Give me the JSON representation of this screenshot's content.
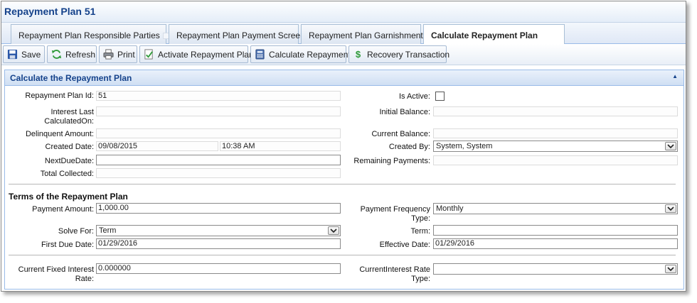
{
  "window": {
    "title": "Repayment Plan 51"
  },
  "tabs": [
    {
      "label": "Repayment Plan Responsible Parties"
    },
    {
      "label": "Repayment Plan Payment Screen"
    },
    {
      "label": "Repayment Plan Garnishments"
    },
    {
      "label": "Calculate Repayment Plan"
    }
  ],
  "toolbar": {
    "save": "Save",
    "refresh": "Refresh",
    "print": "Print",
    "activate": "Activate Repayment Plan",
    "calculate": "Calculate Repayment",
    "recovery": "Recovery Transaction"
  },
  "panel": {
    "title": "Calculate the Repayment Plan"
  },
  "fields": {
    "plan_id_label": "Repayment Plan Id:",
    "plan_id": "51",
    "is_active_label": "Is Active:",
    "interest_last_label_1": "Interest Last",
    "interest_last_label_2": "CalculatedOn:",
    "interest_last": "",
    "initial_balance_label": "Initial Balance:",
    "initial_balance": "",
    "delinquent_label": "Delinquent Amount:",
    "delinquent": "",
    "current_balance_label": "Current Balance:",
    "current_balance": "",
    "created_date_label": "Created Date:",
    "created_date": "09/08/2015",
    "created_time": "10:38 AM",
    "created_by_label": "Created By:",
    "created_by": "System, System",
    "next_due_label": "NextDueDate:",
    "next_due": "",
    "remaining_label": "Remaining Payments:",
    "remaining": "",
    "total_collected_label": "Total Collected:",
    "total_collected": ""
  },
  "terms": {
    "title": "Terms of the Repayment Plan",
    "payment_amount_label": "Payment Amount:",
    "payment_amount": "1,000.00",
    "frequency_label_1": "Payment Frequency",
    "frequency_label_2": "Type:",
    "frequency": "Monthly",
    "solve_for_label": "Solve For:",
    "solve_for": "Term",
    "term_label": "Term:",
    "term": "",
    "first_due_label": "First Due Date:",
    "first_due": "01/29/2016",
    "effective_label": "Effective Date:",
    "effective": "01/29/2016",
    "fixed_rate_label_1": "Current Fixed Interest",
    "fixed_rate_label_2": "Rate:",
    "fixed_rate": "0.000000",
    "rate_type_label_1": "CurrentInterest Rate",
    "rate_type_label_2": "Type:",
    "rate_type": ""
  }
}
